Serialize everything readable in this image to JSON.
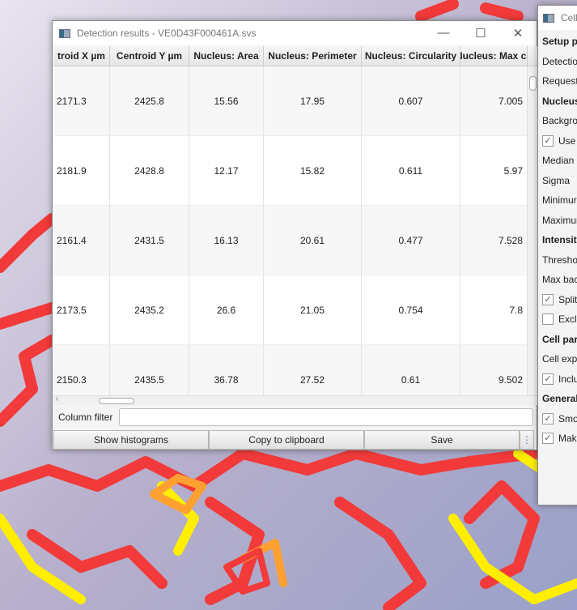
{
  "dialog": {
    "title": "Detection results - VE0D43F000461A.svs",
    "minimize": "—",
    "maximize": "☐",
    "close": "✕",
    "columns": [
      "troid X µm",
      "Centroid Y µm",
      "Nucleus: Area",
      "Nucleus: Perimeter",
      "Nucleus: Circularity",
      "Nucleus: Max ca"
    ],
    "rows": [
      [
        "2171.3",
        "2425.8",
        "15.56",
        "17.95",
        "0.607",
        "7.005"
      ],
      [
        "2181.9",
        "2428.8",
        "12.17",
        "15.82",
        "0.611",
        "5.97"
      ],
      [
        "2161.4",
        "2431.5",
        "16.13",
        "20.61",
        "0.477",
        "7.528"
      ],
      [
        "2173.5",
        "2435.2",
        "26.6",
        "21.05",
        "0.754",
        "7.8"
      ],
      [
        "2150.3",
        "2435.5",
        "36.78",
        "27.52",
        "0.61",
        "9.502"
      ]
    ],
    "column_filter_label": "Column filter",
    "column_filter_value": "",
    "buttons": {
      "histograms": "Show histograms",
      "copy": "Copy to clipboard",
      "save": "Save",
      "more": "⋮"
    }
  },
  "panel": {
    "title": "Cell",
    "items": [
      {
        "t": "Setup p",
        "b": true
      },
      {
        "t": "Detectio"
      },
      {
        "t": "Requeste"
      },
      {
        "t": "Nucleus",
        "b": true
      },
      {
        "t": "Backgrou"
      },
      {
        "t": "Use",
        "cb": true
      },
      {
        "t": "Median"
      },
      {
        "t": "Sigma"
      },
      {
        "t": "Minimur"
      },
      {
        "t": "Maximur"
      },
      {
        "t": "Intensity",
        "b": true
      },
      {
        "t": "Thresho"
      },
      {
        "t": "Max bac"
      },
      {
        "t": "Split",
        "cb": true
      },
      {
        "t": "Exclu",
        "cb": false
      },
      {
        "t": "Cell par",
        "b": true
      },
      {
        "t": "Cell expa"
      },
      {
        "t": "Inclu",
        "cb": true
      },
      {
        "t": "General",
        "b": true
      },
      {
        "t": "Smo",
        "cb": true
      },
      {
        "t": "Mak",
        "cb": true
      }
    ]
  }
}
